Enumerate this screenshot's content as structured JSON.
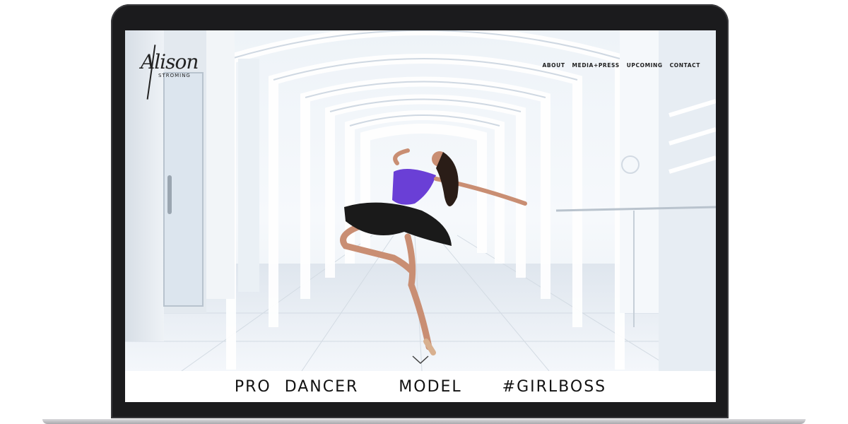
{
  "site": {
    "logo": {
      "script_text": "Alison",
      "wordmark": "STROMING"
    },
    "nav": {
      "items": [
        {
          "label": "ABOUT"
        },
        {
          "label": "MEDIA+PRESS"
        },
        {
          "label": "UPCOMING"
        },
        {
          "label": "CONTACT"
        }
      ]
    },
    "hero": {
      "image": "dancer-in-white-arched-corridor",
      "scroll_icon": "chevron-down-icon"
    },
    "tagline": "PRO DANCER   MODEL   #GIRLBOSS"
  },
  "colors": {
    "bezel": "#1b1b1d",
    "text": "#111111",
    "leotard": "#6a3fd6",
    "tutu": "#1a1a1a",
    "skin": "#c98e73"
  }
}
